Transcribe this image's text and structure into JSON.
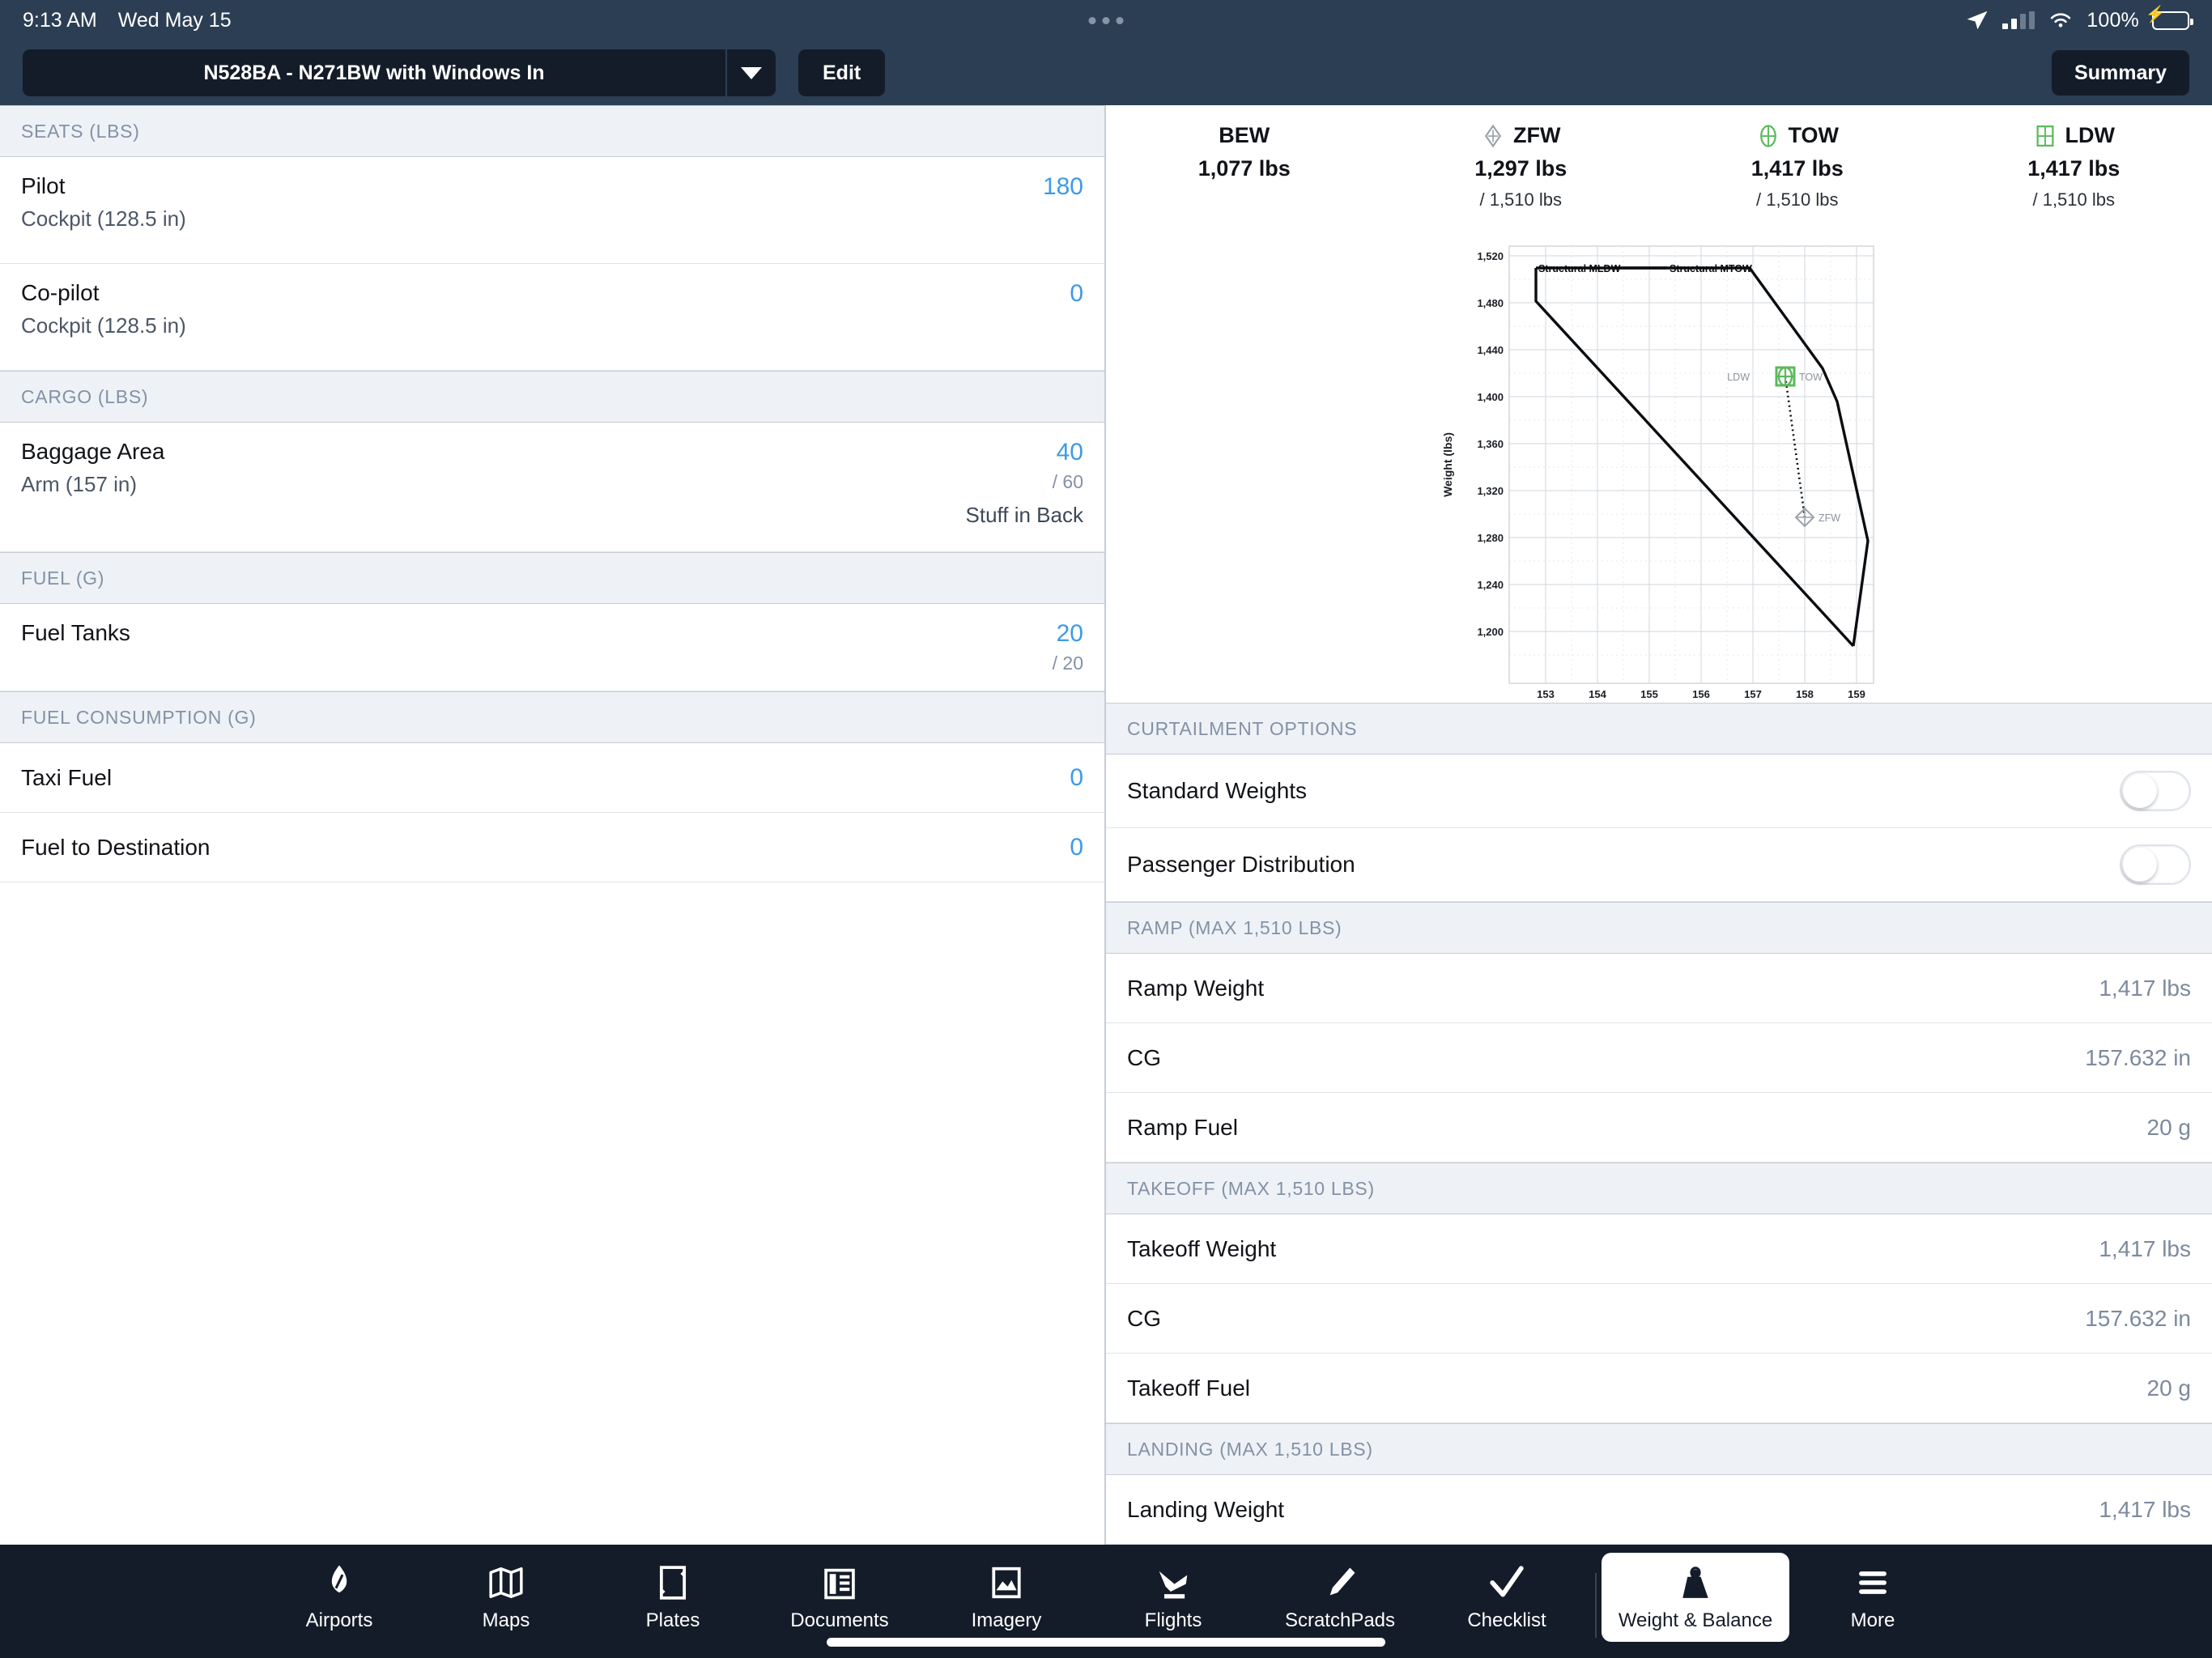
{
  "status_bar": {
    "time": "9:13 AM",
    "date": "Wed May 15",
    "battery_pct": "100%",
    "location_icon": "location-arrow-icon",
    "signal_icon": "cellular-bars-icon",
    "wifi_icon": "wifi-icon",
    "battery_icon": "battery-charging-icon"
  },
  "toolbar": {
    "aircraft": "N528BA - N271BW with Windows In",
    "dropdown_icon": "chevron-down-icon",
    "edit_label": "Edit",
    "summary_label": "Summary"
  },
  "left": {
    "sections": [
      {
        "header": "SEATS (LBS)",
        "rows": [
          {
            "title": "Pilot",
            "sub": "Cockpit (128.5 in)",
            "value": "180",
            "max": "",
            "note": ""
          },
          {
            "title": "Co-pilot",
            "sub": "Cockpit (128.5 in)",
            "value": "0",
            "max": "",
            "note": ""
          }
        ]
      },
      {
        "header": "CARGO (LBS)",
        "rows": [
          {
            "title": "Baggage Area",
            "sub": "Arm (157 in)",
            "value": "40",
            "max": "/ 60",
            "note": "Stuff in Back"
          }
        ]
      },
      {
        "header": "FUEL (G)",
        "rows": [
          {
            "title": "Fuel Tanks",
            "sub": "",
            "value": "20",
            "max": "/ 20",
            "note": ""
          }
        ]
      },
      {
        "header": "FUEL CONSUMPTION (G)",
        "rows": [
          {
            "title": "Taxi Fuel",
            "sub": "",
            "value": "0",
            "max": "",
            "note": ""
          },
          {
            "title": "Fuel to Destination",
            "sub": "",
            "value": "0",
            "max": "",
            "note": ""
          }
        ]
      }
    ]
  },
  "weights": [
    {
      "label": "BEW",
      "icon": "",
      "value": "1,077 lbs",
      "max": ""
    },
    {
      "label": "ZFW",
      "icon": "zfw-diamond-icon",
      "value": "1,297 lbs",
      "max": "/ 1,510 lbs"
    },
    {
      "label": "TOW",
      "icon": "tow-circle-icon",
      "value": "1,417 lbs",
      "max": "/ 1,510 lbs"
    },
    {
      "label": "LDW",
      "icon": "ldw-square-icon",
      "value": "1,417 lbs",
      "max": "/ 1,510 lbs"
    }
  ],
  "chart_data": {
    "type": "line",
    "title": "",
    "xlabel": "",
    "ylabel": "Weight (lbs)",
    "xlim": [
      152.6,
      159.6
    ],
    "ylim": [
      1180,
      1528
    ],
    "xticks": [
      "153",
      "154",
      "155",
      "156",
      "157",
      "158",
      "159"
    ],
    "yticks": [
      "1,200",
      "1,240",
      "1,280",
      "1,320",
      "1,360",
      "1,400",
      "1,440",
      "1,480",
      "1,520"
    ],
    "grid": true,
    "legend": "inline-annotations",
    "annotations": [
      "Structural MLDW",
      "Structural MTOW"
    ],
    "series": [
      {
        "name": "Structural MLDW envelope",
        "points": [
          [
            152.85,
            1510
          ],
          [
            152.85,
            1484
          ],
          [
            159.3,
            1185
          ]
        ]
      },
      {
        "name": "Structural MTOW envelope",
        "points": [
          [
            152.85,
            1510
          ],
          [
            156.9,
            1510
          ],
          [
            158.25,
            1425
          ],
          [
            158.55,
            1396
          ],
          [
            159.2,
            1277
          ],
          [
            159.3,
            1185
          ]
        ]
      },
      {
        "name": "CG shift (TOW to ZFW)",
        "style": "dotted",
        "points": [
          [
            157.632,
            1417
          ],
          [
            158.0,
            1297
          ]
        ]
      }
    ],
    "markers": [
      {
        "label": "LDW",
        "x": 157.632,
        "y": 1417,
        "icon": "ldw-square-icon",
        "color": "#5cb85c",
        "label_side": "left"
      },
      {
        "label": "TOW",
        "x": 157.632,
        "y": 1417,
        "icon": "tow-circle-icon",
        "color": "#5cb85c",
        "label_side": "right"
      },
      {
        "label": "ZFW",
        "x": 158.0,
        "y": 1297,
        "icon": "zfw-diamond-icon",
        "color": "#9aa1ab",
        "label_side": "right"
      }
    ]
  },
  "right": {
    "sections": [
      {
        "header": "CURTAILMENT OPTIONS",
        "rows": [
          {
            "title": "Standard Weights",
            "control": "toggle",
            "state": "off",
            "value": ""
          },
          {
            "title": "Passenger Distribution",
            "control": "toggle",
            "state": "off",
            "value": ""
          }
        ]
      },
      {
        "header": "RAMP (MAX 1,510 LBS)",
        "rows": [
          {
            "title": "Ramp Weight",
            "control": "text",
            "value": "1,417 lbs"
          },
          {
            "title": "CG",
            "control": "text",
            "value": "157.632 in"
          },
          {
            "title": "Ramp Fuel",
            "control": "text",
            "value": "20 g"
          }
        ]
      },
      {
        "header": "TAKEOFF (MAX 1,510 LBS)",
        "rows": [
          {
            "title": "Takeoff Weight",
            "control": "text",
            "value": "1,417 lbs"
          },
          {
            "title": "CG",
            "control": "text",
            "value": "157.632 in"
          },
          {
            "title": "Takeoff Fuel",
            "control": "text",
            "value": "20 g"
          }
        ]
      },
      {
        "header": "LANDING (MAX 1,510 LBS)",
        "rows": [
          {
            "title": "Landing Weight",
            "control": "text",
            "value": "1,417 lbs"
          }
        ]
      }
    ]
  },
  "tabs": [
    {
      "label": "Airports",
      "icon": "airports-icon",
      "selected": false
    },
    {
      "label": "Maps",
      "icon": "maps-icon",
      "selected": false
    },
    {
      "label": "Plates",
      "icon": "plates-icon",
      "selected": false
    },
    {
      "label": "Documents",
      "icon": "documents-icon",
      "selected": false
    },
    {
      "label": "Imagery",
      "icon": "imagery-icon",
      "selected": false
    },
    {
      "label": "Flights",
      "icon": "flights-icon",
      "selected": false
    },
    {
      "label": "ScratchPads",
      "icon": "scratchpads-icon",
      "selected": false
    },
    {
      "label": "Checklist",
      "icon": "checklist-icon",
      "selected": false
    },
    {
      "label": "Weight & Balance",
      "icon": "weight-balance-icon",
      "selected": true
    },
    {
      "label": "More",
      "icon": "hamburger-icon",
      "selected": false
    }
  ],
  "colors": {
    "chrome": "#2b3e54",
    "chrome_dark": "#141c29",
    "accent_blue": "#3d9ae8",
    "muted": "#8491a5",
    "green": "#5cb85c"
  }
}
